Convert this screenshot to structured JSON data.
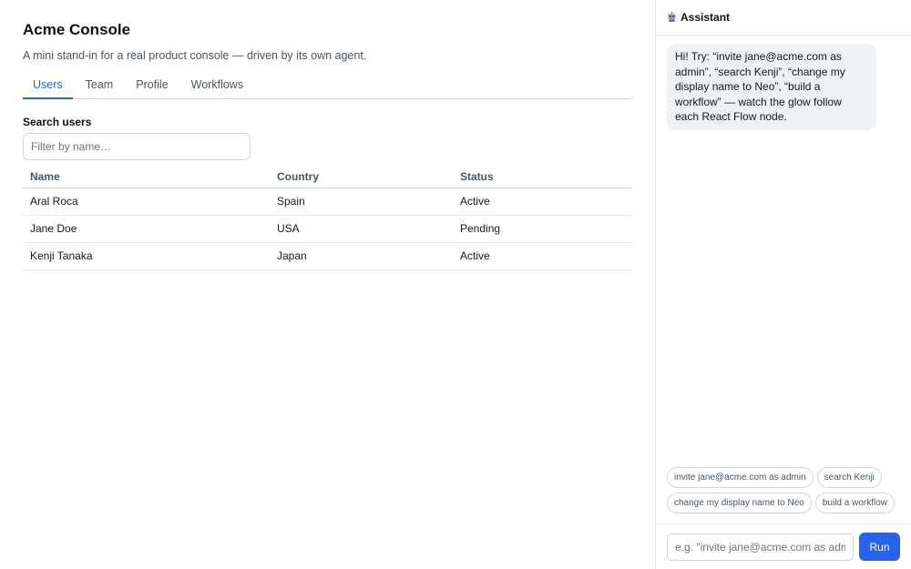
{
  "app": {
    "title": "Acme Console",
    "subtitle": "A mini stand-in for a real product console — driven by its own agent."
  },
  "tabs": [
    {
      "label": "Users",
      "active": true
    },
    {
      "label": "Team",
      "active": false
    },
    {
      "label": "Profile",
      "active": false
    },
    {
      "label": "Workflows",
      "active": false
    }
  ],
  "search": {
    "label": "Search users",
    "placeholder": "Filter by name…",
    "value": ""
  },
  "table": {
    "columns": [
      "Name",
      "Country",
      "Status"
    ],
    "rows": [
      [
        "Aral Roca",
        "Spain",
        "Active"
      ],
      [
        "Jane Doe",
        "USA",
        "Pending"
      ],
      [
        "Kenji Tanaka",
        "Japan",
        "Active"
      ]
    ]
  },
  "assistant": {
    "title": "Assistant",
    "icon": "robot-icon",
    "message": "Hi! Try: “invite jane@acme.com as admin”, “search Kenji”, “change my display name to Neo”, “build a workflow” — watch the glow follow each React Flow node.",
    "suggestions": [
      "invite jane@acme.com as admin",
      "search Kenji",
      "change my display name to Neo",
      "build a workflow"
    ],
    "input_placeholder": "e.g. \"invite jane@acme.com as admin\"",
    "run_label": "Run"
  },
  "colors": {
    "accent": "#2563eb",
    "border": "#d1d5db",
    "bubble": "#f0f1f3"
  }
}
